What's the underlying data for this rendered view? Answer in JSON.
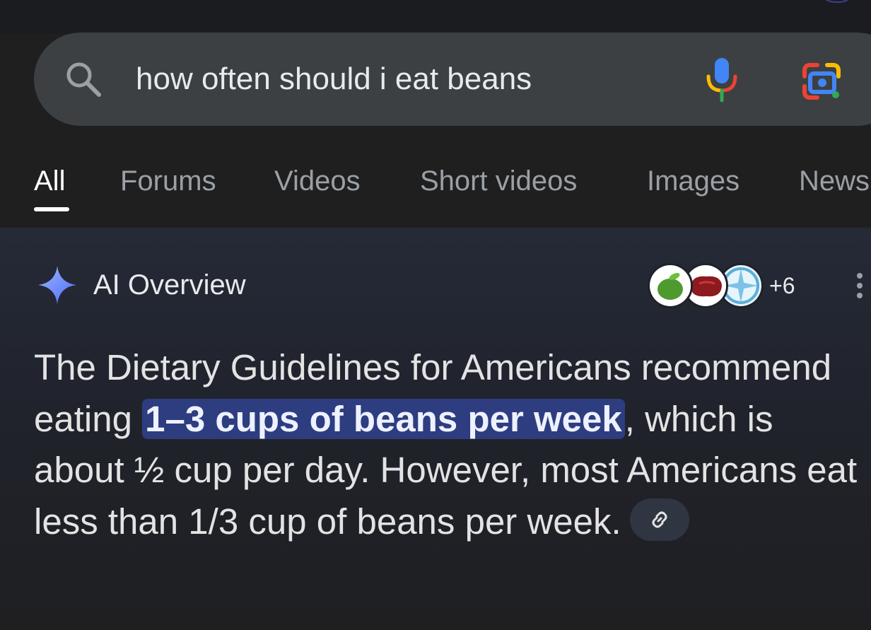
{
  "search": {
    "query": "how often should i eat beans",
    "search_icon": "search-icon",
    "voice_icon": "microphone-icon",
    "lens_icon": "google-lens-icon"
  },
  "tabs": [
    {
      "label": "All",
      "active": true
    },
    {
      "label": "Forums"
    },
    {
      "label": "Videos"
    },
    {
      "label": "Short videos"
    },
    {
      "label": "Images"
    },
    {
      "label": "News"
    }
  ],
  "ai_overview": {
    "title": "AI Overview",
    "sources_more": "+6",
    "text_before": "The Dietary Guidelines for Americans recommend eating ",
    "text_highlight": "1–3 cups of beans per week",
    "text_after": ", which is about ½ cup per day. However, most Americans eat less than 1/3 cup of beans per week.",
    "source_icons": [
      "apple-source-icon",
      "bean-source-icon",
      "pattern-source-icon"
    ],
    "link_icon": "link-icon",
    "menu_icon": "more-vert-icon"
  },
  "colors": {
    "background": "#1f1f1f",
    "search_bar": "#3c4043",
    "highlight": "#2d3d80",
    "tab_inactive": "#9aa0a6",
    "tab_active": "#ffffff"
  }
}
